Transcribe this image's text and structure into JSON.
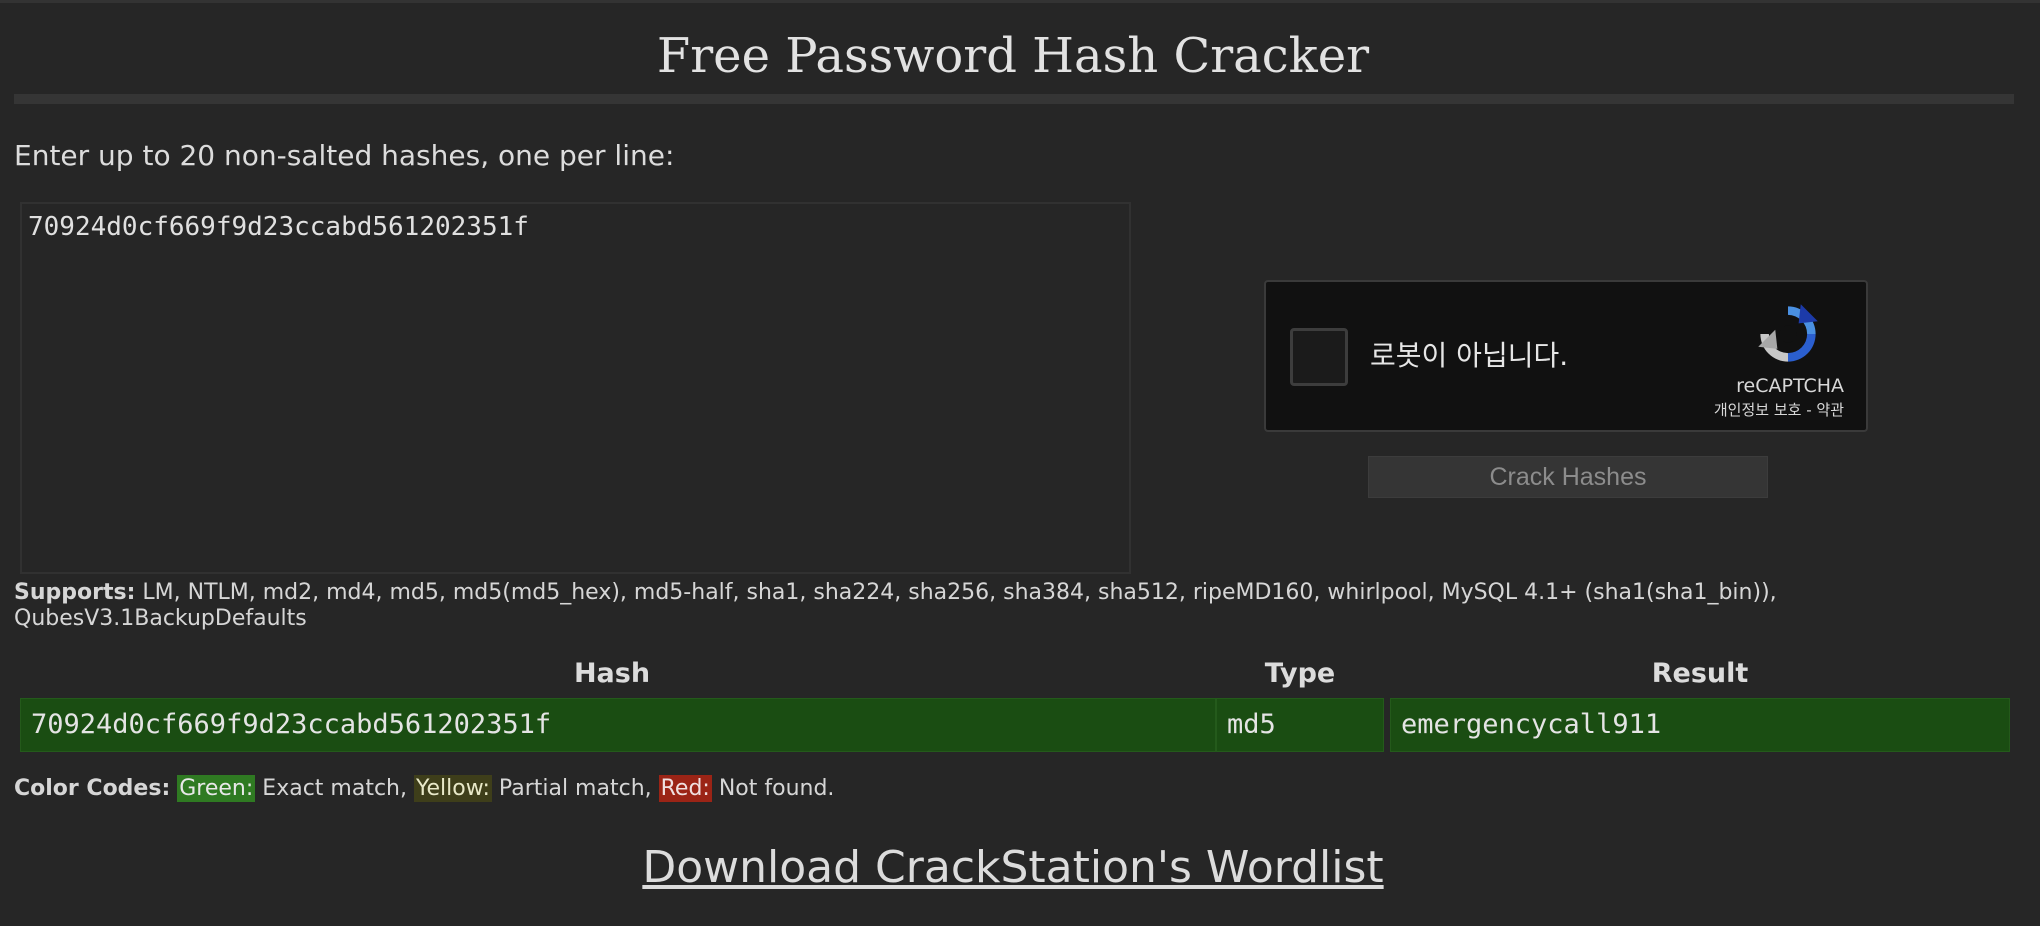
{
  "page": {
    "title": "Free Password Hash Cracker"
  },
  "input": {
    "prompt": "Enter up to 20 non-salted hashes, one per line:",
    "value": "70924d0cf669f9d23ccabd561202351f"
  },
  "recaptcha": {
    "label": "로봇이 아닙니다.",
    "brand": "reCAPTCHA",
    "privacy": "개인정보 보호",
    "separator": " - ",
    "terms": "약관",
    "logo_icon": "recaptcha-icon"
  },
  "crack_button": {
    "label": "Crack Hashes"
  },
  "supports": {
    "label": "Supports:",
    "list": " LM, NTLM, md2, md4, md5, md5(md5_hex), md5-half, sha1, sha224, sha256, sha384, sha512, ripeMD160, whirlpool, MySQL 4.1+ (sha1(sha1_bin)), QubesV3.1BackupDefaults"
  },
  "results": {
    "headers": [
      "Hash",
      "Type",
      "Result"
    ],
    "rows": [
      {
        "hash": "70924d0cf669f9d23ccabd561202351f",
        "type": "md5",
        "result": "emergencycall911",
        "status_color": "#1a4d12"
      }
    ]
  },
  "color_codes": {
    "label": "Color Codes:",
    "green": "Green:",
    "green_desc": " Exact match, ",
    "yellow": "Yellow:",
    "yellow_desc": " Partial match, ",
    "red": "Red:",
    "red_desc": " Not found.",
    "colors": {
      "green": "#2f7a22",
      "yellow": "#3e3e1a",
      "red": "#9b2416"
    }
  },
  "download": {
    "label": "Download CrackStation's Wordlist"
  }
}
